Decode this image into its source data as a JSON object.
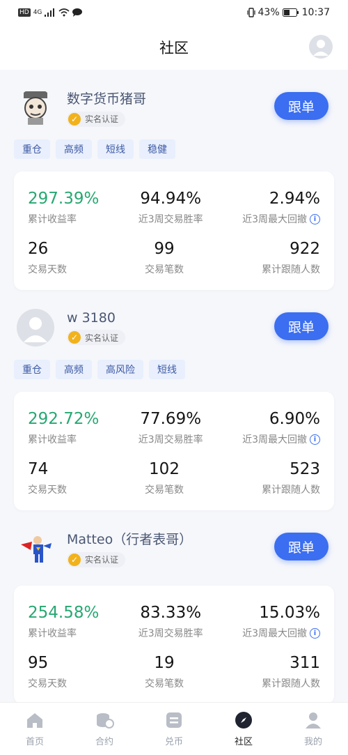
{
  "status_bar": {
    "left_badges": [
      "HD",
      "4G"
    ],
    "battery": "43%",
    "time": "10:37"
  },
  "header": {
    "title": "社区"
  },
  "traders": [
    {
      "name": "数字货币猪哥",
      "avatar_icon": "cartoon-face-icon",
      "verified": "实名认证",
      "follow_label": "跟单",
      "tags": [
        "重仓",
        "高频",
        "短线",
        "稳健"
      ],
      "stats": {
        "total_return": "297.39%",
        "total_return_label": "累计收益率",
        "win_rate": "94.94%",
        "win_rate_label": "近3周交易胜率",
        "max_drawdown": "2.94%",
        "max_drawdown_label": "近3周最大回撤",
        "trade_days": "26",
        "trade_days_label": "交易天数",
        "trade_count": "99",
        "trade_count_label": "交易笔数",
        "followers": "922",
        "followers_label": "累计跟随人数"
      }
    },
    {
      "name": "w 3180",
      "avatar_icon": "default-user-icon",
      "verified": "实名认证",
      "follow_label": "跟单",
      "tags": [
        "重仓",
        "高频",
        "高风险",
        "短线"
      ],
      "stats": {
        "total_return": "292.72%",
        "total_return_label": "累计收益率",
        "win_rate": "77.69%",
        "win_rate_label": "近3周交易胜率",
        "max_drawdown": "6.90%",
        "max_drawdown_label": "近3周最大回撤",
        "trade_days": "74",
        "trade_days_label": "交易天数",
        "trade_count": "102",
        "trade_count_label": "交易笔数",
        "followers": "523",
        "followers_label": "累计跟随人数"
      }
    },
    {
      "name": "Matteo（行者表哥）",
      "avatar_icon": "superhero-icon",
      "verified": "实名认证",
      "follow_label": "跟单",
      "tags": [],
      "stats": {
        "total_return": "254.58%",
        "total_return_label": "累计收益率",
        "win_rate": "83.33%",
        "win_rate_label": "近3周交易胜率",
        "max_drawdown": "15.03%",
        "max_drawdown_label": "近3周最大回撤",
        "trade_days": "95",
        "trade_days_label": "交易天数",
        "trade_count": "19",
        "trade_count_label": "交易笔数",
        "followers": "311",
        "followers_label": "累计跟随人数"
      }
    }
  ],
  "tabbar": {
    "items": [
      {
        "label": "首页",
        "icon": "home-icon"
      },
      {
        "label": "合约",
        "icon": "contract-icon"
      },
      {
        "label": "兑币",
        "icon": "exchange-icon"
      },
      {
        "label": "社区",
        "icon": "compass-icon",
        "active": true
      },
      {
        "label": "我的",
        "icon": "profile-icon"
      }
    ]
  },
  "colors": {
    "accent": "#3b6ef0",
    "positive": "#26a871",
    "verify": "#f2b21b"
  }
}
